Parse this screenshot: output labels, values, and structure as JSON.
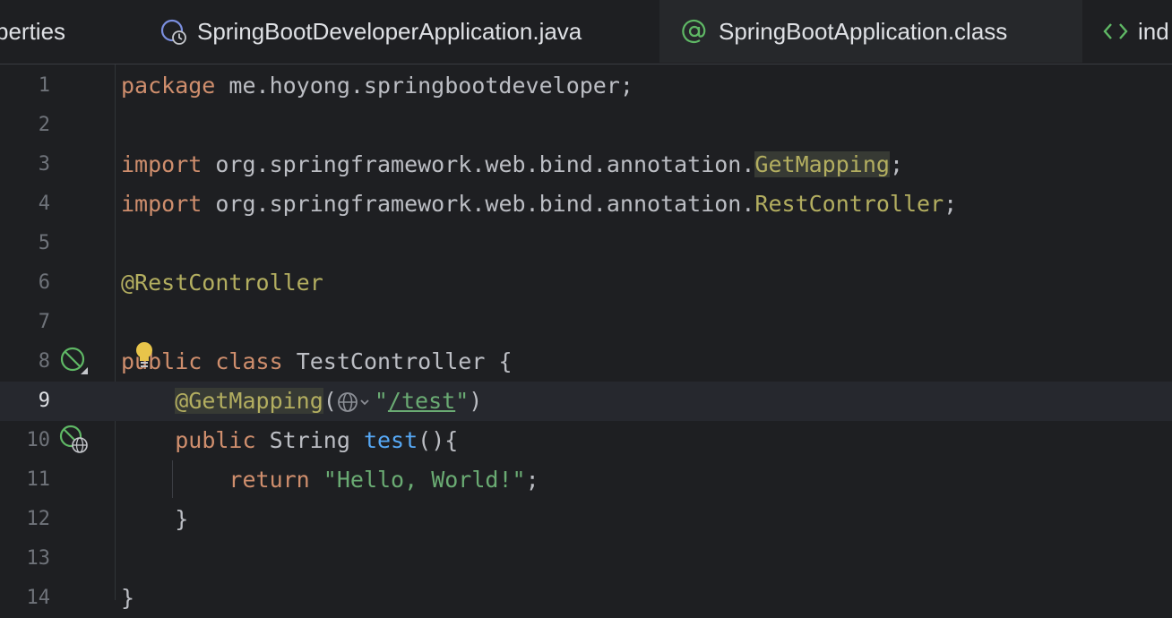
{
  "tabs": [
    {
      "label": "perties",
      "icon": "properties-file-icon",
      "active": false
    },
    {
      "label": "SpringBootDeveloperApplication.java",
      "icon": "spring-boot-application-icon",
      "active": false
    },
    {
      "label": "SpringBootApplication.class",
      "icon": "annotation-icon",
      "active": true
    },
    {
      "label": "ind",
      "icon": "html-file-icon",
      "active": false
    }
  ],
  "editor": {
    "current_line": 9,
    "line_numbers": [
      "1",
      "2",
      "3",
      "4",
      "5",
      "6",
      "7",
      "8",
      "9",
      "10",
      "11",
      "12",
      "13",
      "14"
    ],
    "code": {
      "l1_kw": "package",
      "l1_rest": " me.hoyong.springbootdeveloper;",
      "l3_kw": "import",
      "l3_pkg": " org.springframework.web.bind.annotation.",
      "l3_cls": "GetMapping",
      "l3_end": ";",
      "l4_kw": "import",
      "l4_pkg": " org.springframework.web.bind.annotation.",
      "l4_cls": "RestController",
      "l4_end": ";",
      "l6_ann": "@RestController",
      "l8_kw1": "public",
      "l8_kw2": "class",
      "l8_rest": " TestController {",
      "l9_indent": "    ",
      "l9_ann": "@GetMapping",
      "l9_open": "(",
      "l9_q1": "\"",
      "l9_url": "/test",
      "l9_q2": "\"",
      "l9_close": ")",
      "l10_indent": "    ",
      "l10_kw": "public",
      "l10_type": " String ",
      "l10_fn": "test",
      "l10_rest": "(){",
      "l11_indent": "        ",
      "l11_kw": "return",
      "l11_str": "\"Hello, World!\"",
      "l11_end": ";",
      "l12_text": "    }",
      "l14_text": "}"
    }
  },
  "gutter_icons": {
    "line8": "spring-bean-icon",
    "line10": "spring-web-endpoint-icon"
  },
  "colors": {
    "background": "#1e1f22",
    "keyword": "#cf8e6d",
    "annotation": "#b3ae60",
    "string": "#6aab73",
    "function": "#56a8f5",
    "text": "#bcbec4"
  }
}
